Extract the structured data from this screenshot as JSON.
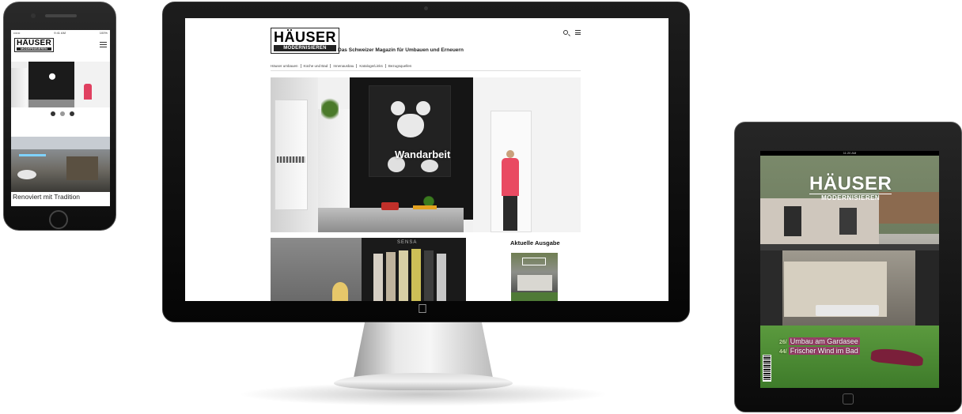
{
  "phone": {
    "status": {
      "carrier": "•••••• ",
      "time": "9:41 AM",
      "battery": "100%"
    },
    "logo": {
      "line1": "HÄUSER",
      "line2": "MODERNISIEREN"
    },
    "caption": "Renoviert mit Tradition"
  },
  "desktop": {
    "logo": {
      "line1": "HÄUSER",
      "line2": "MODERNISIEREN"
    },
    "tagline": "Das Schweizer Magazin für Umbauen und Erneuern",
    "nav": [
      "Häuser umbauen",
      "Küche und Bad",
      "Innenausbau",
      "Kataloge/Links",
      "Bezugsquellen"
    ],
    "hero_overlay": "Wandarbeit",
    "issue_heading": "Aktuelle Ausgabe",
    "article_sign": "SENSA"
  },
  "tablet": {
    "status_time": "11:20 AM",
    "cover_logo": {
      "line1": "HÄUSER",
      "line2": "MODERNISIEREN"
    },
    "headlines": [
      {
        "num": "26/",
        "text": "Umbau am Gardasee"
      },
      {
        "num": "44/",
        "text": "Frischer Wind im Bad"
      }
    ]
  },
  "colors": {
    "frame": "#0d0d0d",
    "accent": "#b0267a",
    "cover_green": "#c9e8a6"
  },
  "icons": [
    "search-icon",
    "menu-icon",
    "apple-logo-icon",
    "home-button-icon"
  ]
}
